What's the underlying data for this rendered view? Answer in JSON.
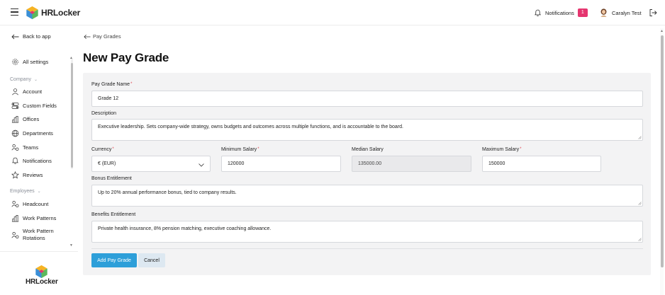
{
  "app": {
    "brand": "HRLocker"
  },
  "header": {
    "notifications_label": "Notifications",
    "notifications_count": "1",
    "user_name": "Caralyn Test"
  },
  "sidebar": {
    "back_label": "Back to app",
    "all_settings": "All settings",
    "sections": [
      {
        "label": "Company",
        "items": [
          "Account",
          "Custom Fields",
          "Offices",
          "Departments",
          "Teams",
          "Notifications",
          "Reviews"
        ]
      },
      {
        "label": "Employees",
        "items": [
          "Headcount",
          "Work Patterns",
          "Work Pattern Rotations"
        ]
      }
    ],
    "footer_brand": "HRLocker"
  },
  "breadcrumb": {
    "back_label": "Pay Grades"
  },
  "page": {
    "title": "New Pay Grade"
  },
  "form": {
    "pay_grade_name": {
      "label": "Pay Grade Name",
      "value": "Grade 12"
    },
    "description": {
      "label": "Description",
      "value": "Executive leadership. Sets company-wide strategy, owns budgets and outcomes across multiple functions, and is accountable to the board."
    },
    "currency": {
      "label": "Currency",
      "value": "€ (EUR)"
    },
    "minimum_salary": {
      "label": "Minimum Salary",
      "value": "120000"
    },
    "median_salary": {
      "label": "Median Salary",
      "value": "135000.00"
    },
    "maximum_salary": {
      "label": "Maximum Salary",
      "value": "150000"
    },
    "bonus_entitlement": {
      "label": "Bonus Entitlement",
      "value": "Up to 20% annual performance bonus, tied to company results."
    },
    "benefits_entitlement": {
      "label": "Benefits Entitlement",
      "value": "Private health insurance, 8% pension matching, executive coaching allowance."
    },
    "submit_label": "Add Pay Grade",
    "cancel_label": "Cancel"
  },
  "colors": {
    "primary": "#2e9fd9",
    "badge": "#e5356f",
    "required": "#e0454f"
  }
}
